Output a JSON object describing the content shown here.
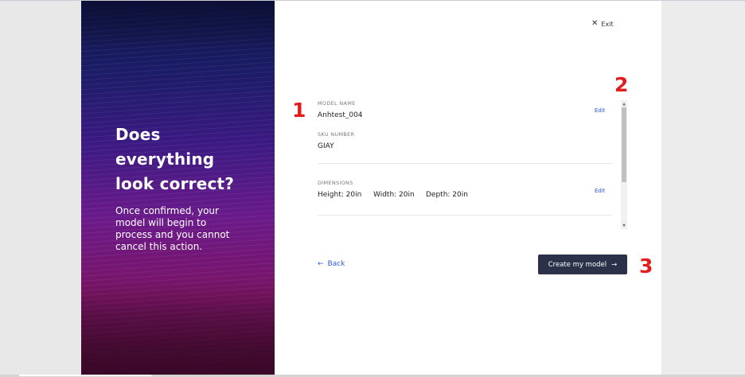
{
  "colors": {
    "accent": "#2a5bd7",
    "button_bg": "#2b3149",
    "marker": "#e11d1d"
  },
  "hero": {
    "headline_lines": [
      "Does",
      "everything",
      "look correct?"
    ],
    "subtext_lines": [
      "Once confirmed, your",
      "model will begin to",
      "process and you cannot",
      "cancel this action."
    ]
  },
  "header": {
    "exit_icon": "close-icon",
    "exit_label": "Exit"
  },
  "review": {
    "model_name_label": "MODEL NAME",
    "model_name_value": "Anhtest_004",
    "sku_label": "SKU NUMBER",
    "sku_value": "GIAY",
    "dimensions_label": "DIMENSIONS",
    "height": "Height: 20in",
    "width": "Width: 20in",
    "depth": "Depth: 20in",
    "edit_label": "Edit"
  },
  "footer": {
    "back_icon": "arrow-left-icon",
    "back_label": "Back",
    "create_label": "Create my model",
    "create_icon": "arrow-right-icon"
  },
  "markers": [
    "1",
    "2",
    "3"
  ]
}
